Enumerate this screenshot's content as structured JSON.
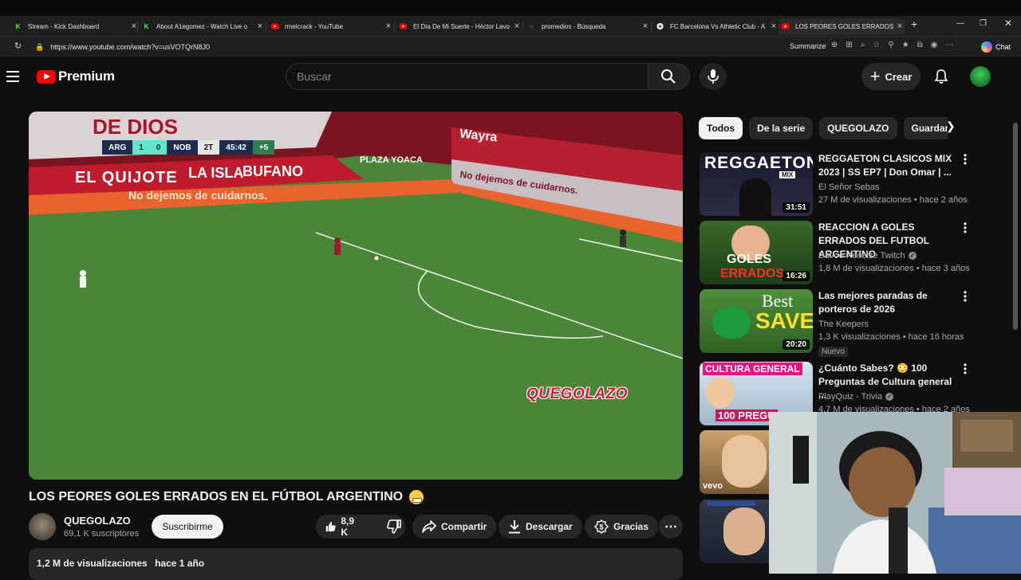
{
  "browser": {
    "tabs": [
      {
        "title": "Stream - Kick Dashboard",
        "favicon": "kick-icon"
      },
      {
        "title": "About A1egomez - Watch Live o",
        "favicon": "kick-icon"
      },
      {
        "title": "rmelcrack - YouTube",
        "favicon": "youtube-icon"
      },
      {
        "title": "El Día De Mi Suerte - Héctor Lavo",
        "favicon": "youtube-icon"
      },
      {
        "title": "promedios - Búsqueda",
        "favicon": "search-icon"
      },
      {
        "title": "FC Barcelona Vs Athletic Club - A",
        "favicon": "soccer-icon"
      },
      {
        "title": "LOS PEORES GOLES ERRADOS EN",
        "favicon": "youtube-icon"
      }
    ],
    "url": "https://www.youtube.com/watch?v=usVOTQrN8J0",
    "summarize_label": "Summarize",
    "chat_label": "Chat"
  },
  "youtube": {
    "logo_text": "Premium",
    "search_placeholder": "Buscar",
    "create_label": "Crear",
    "video": {
      "title": "LOS PEORES GOLES ERRADOS EN EL FÚTBOL ARGENTINO",
      "scoreboard": {
        "home": "ARG",
        "home_score": "1",
        "away_score": "0",
        "away": "NOB",
        "half": "2T",
        "clock": "45:42",
        "added": "+5"
      },
      "watermark": "QUEGOLAZO",
      "ads": {
        "banner_top": "DE DIOS",
        "banner_row": "EL QUIJOTE",
        "banner_isla": "LA ISLA",
        "banner_bufano": "BUFANO",
        "banner_plaza": "PLAZA YOACA",
        "wayra": "Wayra",
        "board": "No dejemos de cuidarnos."
      }
    },
    "channel": {
      "name": "QUEGOLAZO",
      "subscribers": "69,1 K suscriptores",
      "subscribe_label": "Suscribirme"
    },
    "actions": {
      "likes": "8,9 K",
      "share": "Compartir",
      "download": "Descargar",
      "thanks": "Gracias"
    },
    "description": {
      "views": "1,2 M de visualizaciones",
      "date": "hace 1 año"
    },
    "chips": [
      "Todos",
      "De la serie",
      "QUEGOLAZO",
      "Guardar"
    ],
    "recommendations": [
      {
        "title": "REGGAETON CLASICOS MIX 2023 | SS EP7 | Don Omar | ...",
        "channel": "El Señor Sebas",
        "meta": "27 M de visualizaciones • hace 2 años",
        "duration": "31:51",
        "thumb_text": "REGGAETON",
        "thumb_sub": "MIX"
      },
      {
        "title": "REACCION A GOLES ERRADOS DEL FUTBOL ARGENTINO",
        "channel": "Davoo Xeneize Twitch",
        "meta": "1,8 M de visualizaciones • hace 3 años",
        "duration": "16:26",
        "thumb_text": "GOLES",
        "thumb_sub": "ERRADOS"
      },
      {
        "title": "Las mejores paradas de porteros de 2026",
        "channel": "The Keepers",
        "meta": "1,3 K visualizaciones • hace 16 horas",
        "duration": "20:20",
        "badge": "Nuevo",
        "thumb_text": "Best",
        "thumb_sub": "SAVE"
      },
      {
        "title": "¿Cuánto Sabes? 😳 100 Preguntas de Cultura general ...",
        "channel": "PlayQuiz - Trivia",
        "meta": "4,7 M de visualizaciones • hace 2 años",
        "thumb_text": "CULTURA GENERAL",
        "thumb_sub": "100 PREGU"
      },
      {
        "thumb_logo": "vevo"
      }
    ]
  }
}
